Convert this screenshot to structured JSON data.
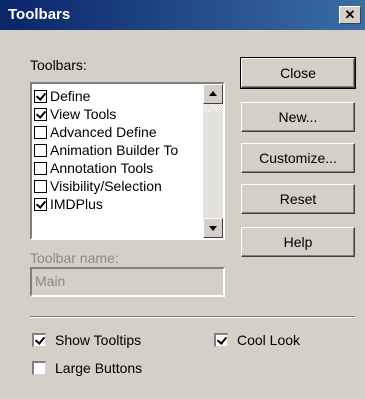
{
  "window": {
    "title": "Toolbars",
    "close_glyph": "✕"
  },
  "toolbars_label": "Toolbars:",
  "toolbars_list": [
    {
      "label": "Define",
      "checked": true
    },
    {
      "label": "View Tools",
      "checked": true
    },
    {
      "label": "Advanced Define",
      "checked": false
    },
    {
      "label": "Animation Builder To",
      "checked": false
    },
    {
      "label": "Annotation Tools",
      "checked": false
    },
    {
      "label": "Visibility/Selection",
      "checked": false
    },
    {
      "label": "IMDPlus",
      "checked": true
    }
  ],
  "buttons": {
    "close": "Close",
    "new": "New...",
    "customize": "Customize...",
    "reset": "Reset",
    "help": "Help"
  },
  "toolbar_name": {
    "label": "Toolbar name:",
    "value": "Main"
  },
  "options": {
    "show_tooltips": {
      "label": "Show Tooltips",
      "checked": true
    },
    "cool_look": {
      "label": "Cool Look",
      "checked": true
    },
    "large_buttons": {
      "label": "Large Buttons",
      "checked": false
    }
  },
  "icons": {
    "close": "close-icon",
    "scroll_up": "chevron-up-icon",
    "scroll_down": "chevron-down-icon"
  },
  "colors": {
    "titlebar_start": "#0a246a",
    "titlebar_end": "#3a6ea5",
    "dialog_bg": "#d4d0c8"
  }
}
